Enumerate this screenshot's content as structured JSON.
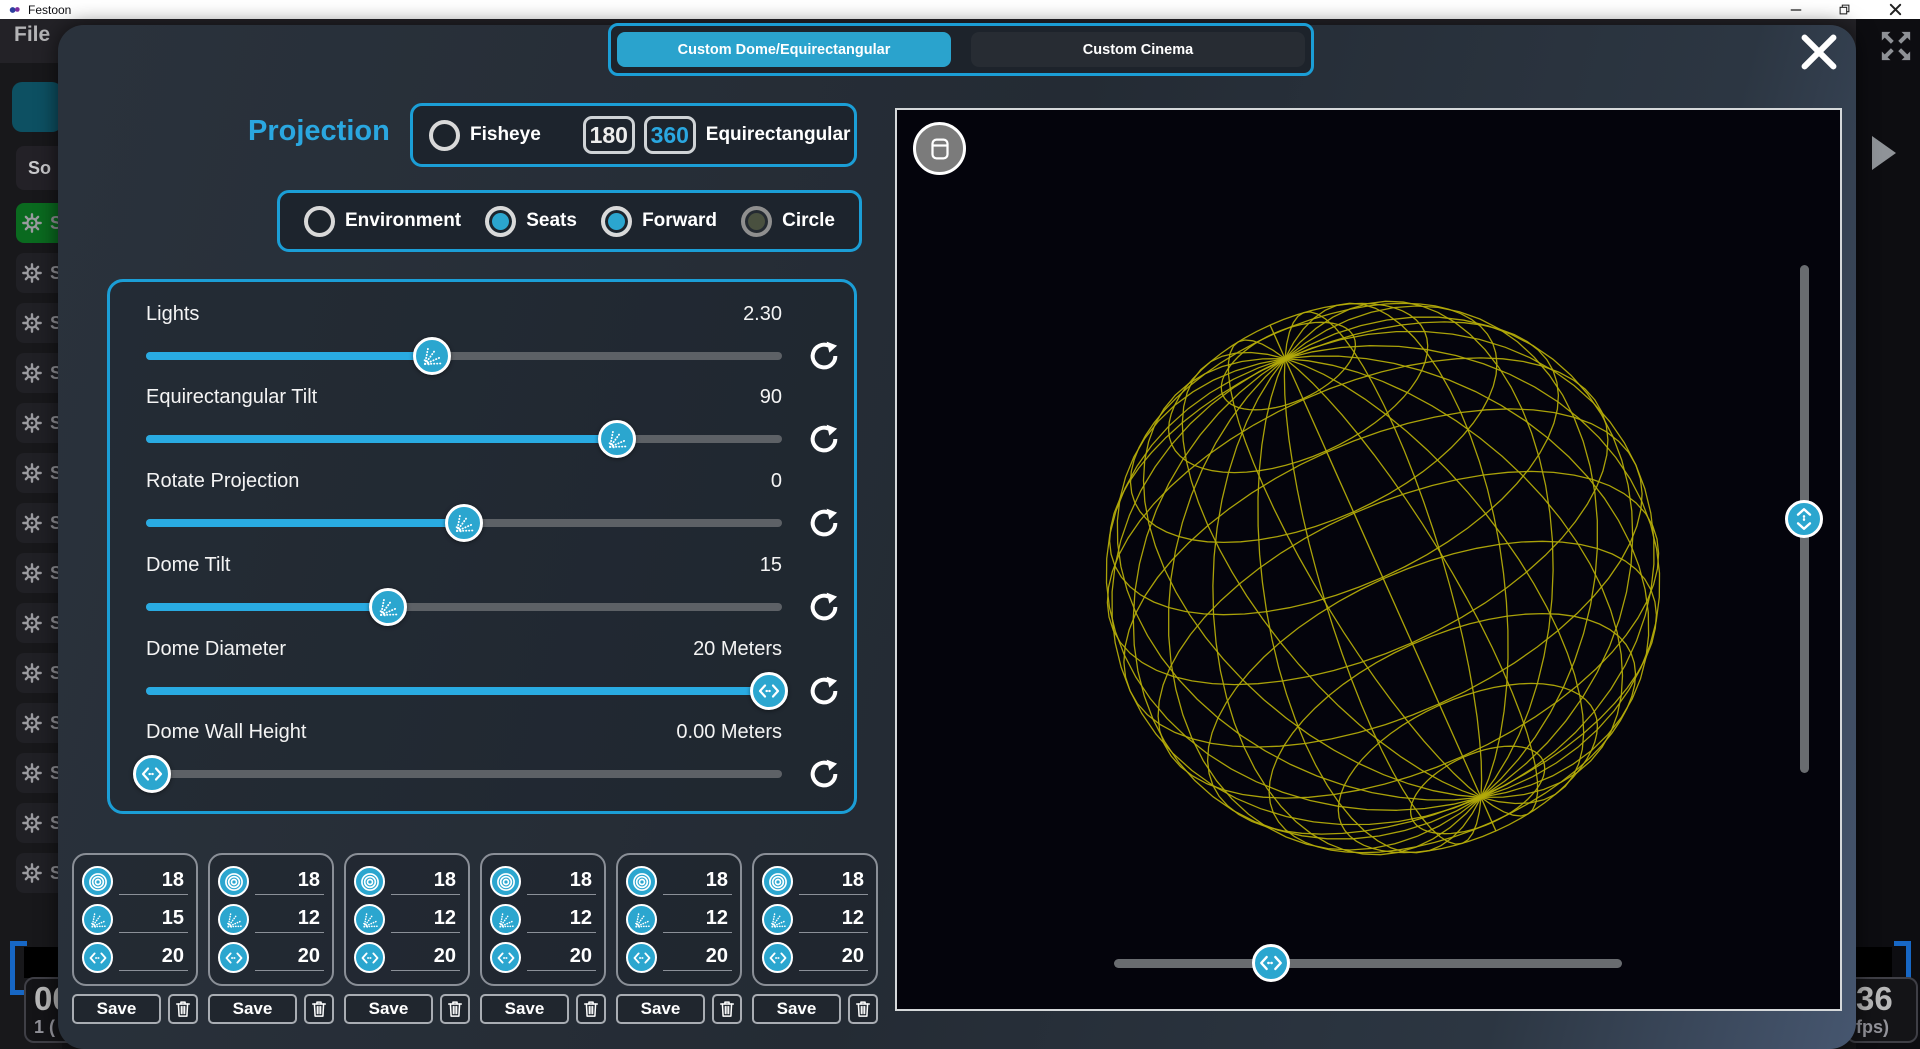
{
  "titlebar": {
    "app_title": "Festoon"
  },
  "menubar": {
    "file_label": "File"
  },
  "modal": {
    "tabs": [
      {
        "label": "Custom Dome/Equirectangular",
        "active": true
      },
      {
        "label": "Custom Cinema",
        "active": false
      }
    ],
    "projection": {
      "title": "Projection",
      "fisheye_label": "Fisheye",
      "deg180": "180",
      "deg360": "360",
      "equirect_label": "Equirectangular",
      "modes": [
        {
          "label": "Environment",
          "state": "off"
        },
        {
          "label": "Seats",
          "state": "on"
        },
        {
          "label": "Forward",
          "state": "on"
        },
        {
          "label": "Circle",
          "state": "dim"
        }
      ]
    },
    "sliders": [
      {
        "label": "Lights",
        "value": "2.30",
        "percent": 45,
        "handle_icon": "tilt-fan-icon"
      },
      {
        "label": "Equirectangular Tilt",
        "value": "90",
        "percent": 74,
        "handle_icon": "tilt-fan-icon"
      },
      {
        "label": "Rotate Projection",
        "value": "0",
        "percent": 50,
        "handle_icon": "tilt-fan-icon"
      },
      {
        "label": "Dome Tilt",
        "value": "15",
        "percent": 38,
        "handle_icon": "tilt-fan-icon"
      },
      {
        "label": "Dome Diameter",
        "value": "20 Meters",
        "percent": 98,
        "handle_icon": "width-arrows-icon"
      },
      {
        "label": "Dome Wall Height",
        "value": "0.00 Meters",
        "percent": 1,
        "handle_icon": "width-arrows-icon"
      }
    ],
    "presets": {
      "save_label": "Save",
      "cards": [
        {
          "rows": [
            {
              "icon": "target-icon",
              "value": "18"
            },
            {
              "icon": "tilt-fan-icon",
              "value": "15"
            },
            {
              "icon": "width-arrows-icon",
              "value": "20"
            }
          ]
        },
        {
          "rows": [
            {
              "icon": "target-icon",
              "value": "18"
            },
            {
              "icon": "tilt-fan-icon",
              "value": "12"
            },
            {
              "icon": "width-arrows-icon",
              "value": "20"
            }
          ]
        },
        {
          "rows": [
            {
              "icon": "target-icon",
              "value": "18"
            },
            {
              "icon": "tilt-fan-icon",
              "value": "12"
            },
            {
              "icon": "width-arrows-icon",
              "value": "20"
            }
          ]
        },
        {
          "rows": [
            {
              "icon": "target-icon",
              "value": "18"
            },
            {
              "icon": "tilt-fan-icon",
              "value": "12"
            },
            {
              "icon": "width-arrows-icon",
              "value": "20"
            }
          ]
        },
        {
          "rows": [
            {
              "icon": "target-icon",
              "value": "18"
            },
            {
              "icon": "tilt-fan-icon",
              "value": "12"
            },
            {
              "icon": "width-arrows-icon",
              "value": "20"
            }
          ]
        },
        {
          "rows": [
            {
              "icon": "target-icon",
              "value": "18"
            },
            {
              "icon": "tilt-fan-icon",
              "value": "12"
            },
            {
              "icon": "width-arrows-icon",
              "value": "20"
            }
          ]
        }
      ]
    },
    "preview": {
      "vertical_slider_percent": 50,
      "horizontal_slider_percent": 31,
      "sphere_color": "#b3ab0a"
    }
  },
  "background": {
    "sidebar": {
      "header_label": "So",
      "row_letter": "S",
      "row_count": 14,
      "selected_row": 0
    },
    "timeline": {
      "left_big": "00",
      "left_small": "1 (",
      "right_big": "36",
      "right_small": "fps)"
    }
  },
  "icons": {
    "gear-icon": "gear glyph",
    "target-icon": "concentric circles",
    "tilt-fan-icon": "dotted rays fanning from arc",
    "width-arrows-icon": "left-right chevrons with dots",
    "height-arrows-icon": "up-down chevrons with dots",
    "reset-icon": "circular arrow",
    "trash-icon": "trash can outline",
    "dome-icon": "dome outline",
    "expand-icon": "four diagonal arrows",
    "close-icon": "X"
  },
  "colors": {
    "accent_blue": "#29abe2",
    "border_blue": "#1b9ed6",
    "handle_teal": "#2ba6cf",
    "tab_active": "#2aa3cd",
    "selected_green": "#0a6a1f",
    "sphere": "#b3ab0a",
    "bracket_blue": "#1767c5"
  }
}
